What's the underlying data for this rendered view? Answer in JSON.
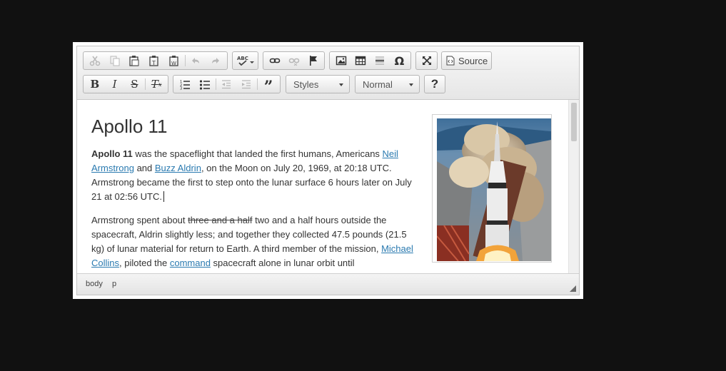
{
  "toolbar": {
    "row1": {
      "clipboard": [
        "cut-icon",
        "copy-icon",
        "paste-icon",
        "paste-text-icon",
        "paste-word-icon"
      ],
      "history": [
        "undo-icon",
        "redo-icon"
      ],
      "spell": "spellcheck-icon",
      "links": [
        "link-icon",
        "unlink-icon",
        "anchor-icon"
      ],
      "insert": [
        "image-icon",
        "table-icon",
        "horizontal-rule-icon",
        "special-char-icon"
      ],
      "maximize": "maximize-icon",
      "source_label": "Source"
    },
    "row2": {
      "basicstyles": [
        "bold-icon",
        "italic-icon",
        "strike-icon",
        "remove-format-icon"
      ],
      "lists": [
        "numbered-list-icon",
        "bulleted-list-icon",
        "outdent-icon",
        "indent-icon",
        "blockquote-icon"
      ],
      "styles_label": "Styles",
      "format_label": "Normal",
      "help": "?"
    }
  },
  "document": {
    "title": "Apollo 11",
    "p1": {
      "bold": "Apollo 11",
      "t1": " was the spaceflight that landed the first humans, Americans ",
      "link1": "Neil Armstrong",
      "t2": " and ",
      "link2": "Buzz Aldrin",
      "t3": ", on the Moon on July 20, 1969, at 20:18 UTC. Armstrong became the first to step onto the lunar surface 6 hours later on July 21 at 02:56 UTC."
    },
    "p2": {
      "t1": "Armstrong spent about ",
      "struck": "three and a half",
      "t2": " two and a half hours outside the spacecraft, Aldrin slightly less; and together they collected 47.5 pounds (21.5 kg) of lunar material for return to Earth. A third member of the mission, ",
      "link1": "Michael Collins",
      "t3": ", piloted the ",
      "link2": "command",
      "t4": " spacecraft alone in lunar orbit until"
    }
  },
  "statusbar": {
    "path": [
      "body",
      "p"
    ]
  },
  "colors": {
    "link": "#2a7ab0",
    "page_bg": "#111111"
  }
}
